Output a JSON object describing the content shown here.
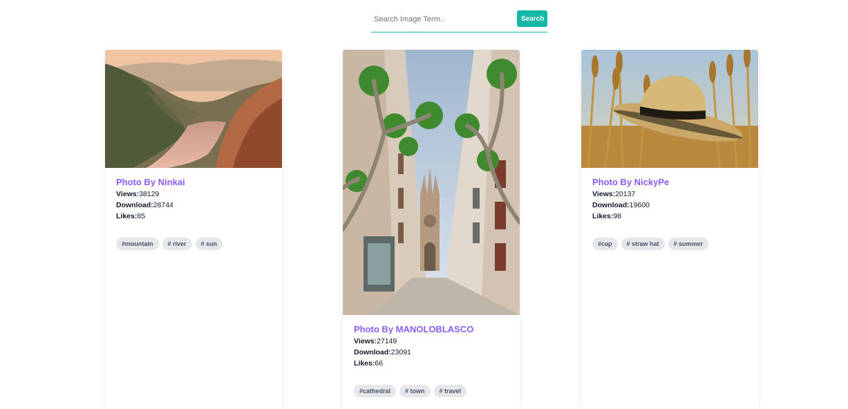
{
  "search": {
    "placeholder": "Search Image Term..",
    "button_label": "Search"
  },
  "accent_color": "#14b8a6",
  "title_color": "#8b5cf6",
  "cards": [
    {
      "title": "Photo By Ninkai",
      "views_label": "Views:",
      "views": "38129",
      "downloads_label": "Download:",
      "downloads": "28744",
      "likes_label": "Likes:",
      "likes": "85",
      "tags": [
        "#mountain",
        "# river",
        "# sun"
      ]
    },
    {
      "title": "Photo By MANOLOBLASCO",
      "views_label": "Views:",
      "views": "27149",
      "downloads_label": "Download:",
      "downloads": "23091",
      "likes_label": "Likes:",
      "likes": "66",
      "tags": [
        "#cathedral",
        "# town",
        "# travel"
      ]
    },
    {
      "title": "Photo By NickyPe",
      "views_label": "Views:",
      "views": "20137",
      "downloads_label": "Download:",
      "downloads": "19600",
      "likes_label": "Likes:",
      "likes": "98",
      "tags": [
        "#cap",
        "# straw hat",
        "# summer"
      ]
    }
  ]
}
